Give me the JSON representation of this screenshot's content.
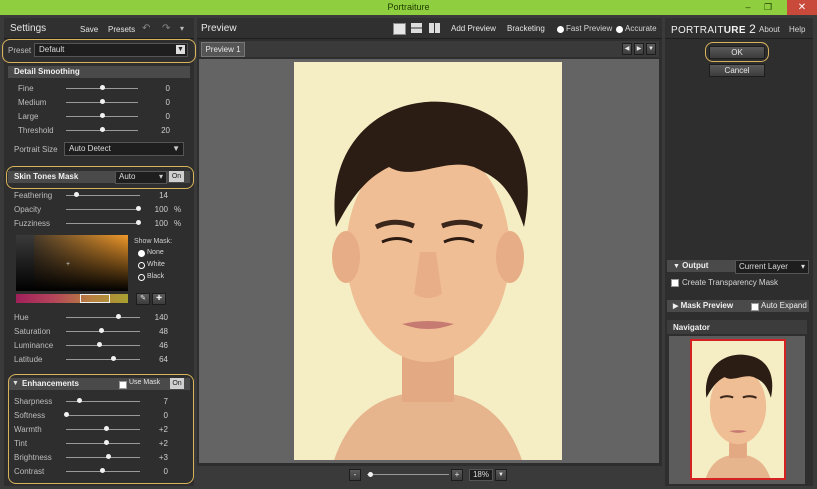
{
  "window": {
    "title": "Portraiture"
  },
  "settings": {
    "title": "Settings",
    "save": "Save",
    "presets": "Presets",
    "preset_label": "Preset",
    "preset_value": "Default",
    "detail_smoothing": {
      "title": "Detail Smoothing",
      "fine": {
        "label": "Fine",
        "value": "0"
      },
      "medium": {
        "label": "Medium",
        "value": "0"
      },
      "large": {
        "label": "Large",
        "value": "0"
      },
      "threshold": {
        "label": "Threshold",
        "value": "20"
      },
      "portrait_size_label": "Portrait Size",
      "portrait_size_value": "Auto Detect"
    },
    "skin_tones": {
      "title": "Skin Tones Mask",
      "mode": "Auto",
      "on": "On",
      "feathering": {
        "label": "Feathering",
        "value": "14"
      },
      "opacity": {
        "label": "Opacity",
        "value": "100",
        "unit": "%"
      },
      "fuzziness": {
        "label": "Fuzziness",
        "value": "100",
        "unit": "%"
      },
      "show_mask": "Show Mask:",
      "mask_none": "None",
      "mask_white": "White",
      "mask_black": "Black",
      "hue": {
        "label": "Hue",
        "value": "140"
      },
      "saturation": {
        "label": "Saturation",
        "value": "48"
      },
      "luminance": {
        "label": "Luminance",
        "value": "46"
      },
      "latitude": {
        "label": "Latitude",
        "value": "64"
      }
    },
    "enhancements": {
      "title": "Enhancements",
      "use_mask": "Use Mask",
      "on": "On",
      "sharpness": {
        "label": "Sharpness",
        "value": "7"
      },
      "softness": {
        "label": "Softness",
        "value": "0"
      },
      "warmth": {
        "label": "Warmth",
        "value": "+2"
      },
      "tint": {
        "label": "Tint",
        "value": "+2"
      },
      "brightness": {
        "label": "Brightness",
        "value": "+3"
      },
      "contrast": {
        "label": "Contrast",
        "value": "0"
      }
    }
  },
  "preview": {
    "title": "Preview",
    "add_preview": "Add Preview",
    "bracketing": "Bracketing",
    "fast_preview": "Fast Preview",
    "accurate": "Accurate",
    "tab": "Preview 1",
    "zoom": "18%",
    "zoom_minus": "-",
    "zoom_plus": "+"
  },
  "right": {
    "brand_a": "Portrait",
    "brand_b": "ure",
    "brand_num": "2",
    "about": "About",
    "help": "Help",
    "ok": "OK",
    "cancel": "Cancel",
    "output_title": "Output",
    "output_value": "Current Layer",
    "create_transparency": "Create Transparency Mask",
    "mask_preview": "Mask Preview",
    "auto_expand": "Auto Expand",
    "navigator": "Navigator"
  },
  "colors": {
    "accent_ring": "#d8b35a",
    "titlebar": "#8fcf3f",
    "nav_frame": "#d22222"
  }
}
